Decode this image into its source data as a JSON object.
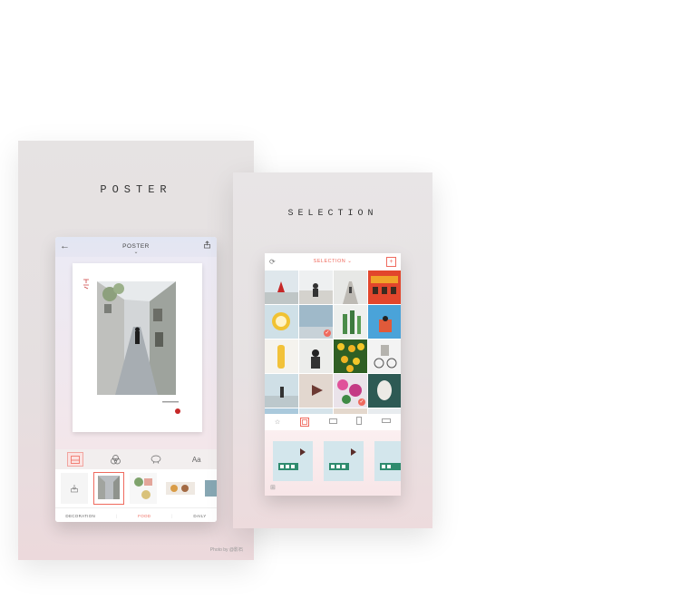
{
  "left_card": {
    "title": "POSTER",
    "phone": {
      "top_title": "POSTER",
      "caret": "⌄",
      "back_icon": "arrow-left-icon",
      "share_icon": "share-icon",
      "tools": [
        "layout-icon",
        "filters-icon",
        "sticker-icon",
        "text-icon"
      ],
      "tool_text_label": "Aa",
      "tabs": [
        "DECORATION",
        "FOOD",
        "DAILY"
      ],
      "active_tab": "FOOD"
    },
    "credit": "Photo by @影石"
  },
  "right_card": {
    "title": "SELECTION",
    "phone": {
      "top_title": "SELECTION",
      "caret": "⌄",
      "add_label": "+"
    }
  },
  "colors": {
    "accent": "#ef6a5e"
  }
}
